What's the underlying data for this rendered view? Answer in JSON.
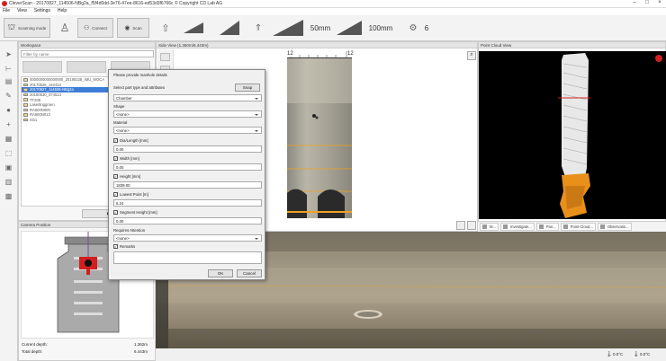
{
  "titlebar": {
    "title": "CleverScan - 20170827_114506-NBg2a_f5f4d0dd-3e76-47ee-8616-ed53d3f6766c © Copyright CD Lab AG"
  },
  "menu": [
    "File",
    "View",
    "Settings",
    "Help"
  ],
  "toolbar": {
    "scanning_mode": "Scanning mode",
    "connect": "Connect",
    "scan": "Scan",
    "distance1": "50mm",
    "distance2": "100mm",
    "count": "6"
  },
  "workspace": {
    "title": "Workspace",
    "filter_placeholder": "Filter by name",
    "process": "Process",
    "items": [
      "0000000000000000_20190228_IMU_MOCA",
      "20170526_142424",
      "20170827_114506-NBg2a",
      "20180530_074513",
      "TT205",
      "Laserlinggroen",
      "RA500N000",
      "RA500N013",
      "mb1"
    ],
    "selected_index": 2
  },
  "camera": {
    "title": "Camera Position",
    "current_depth_label": "Current depth:",
    "current_depth": "1.362m",
    "total_depth_label": "Total depth:",
    "total_depth": "6.443m"
  },
  "sideview": {
    "title": "Side View (1.350m/6.443m)",
    "ruler": [
      "12",
      "12"
    ]
  },
  "pointcloud": {
    "title": "Point Cloud View"
  },
  "bottom_tabs": [
    "M...",
    "Investigate...",
    "Pan...",
    "Point Cloud...",
    "Observatio..."
  ],
  "status": {
    "temp1": "0.0°C",
    "temp2": "0.0°C"
  },
  "dialog": {
    "title": "Please provide manhole details",
    "select_label": "Select part type and attributes",
    "snap": "Snap",
    "part_type": "Chamber",
    "shape_label": "Shape",
    "shape_value": "<none>",
    "material_label": "Material",
    "material_value": "<none>",
    "dia_label": "Dia/Length [mm]",
    "dia_value": "0.00",
    "width_label": "Width [mm]",
    "width_value": "0.00",
    "height_label": "Height [mm]",
    "height_value": "1839.00",
    "lowest_label": "Lowest Point [m]",
    "lowest_value": "6.24",
    "segment_label": "Segment Height [mm]",
    "segment_value": "0.00",
    "attention_label": "Requires Attention",
    "attention_value": "<none>",
    "remarks_label": "Remarks",
    "remarks_value": "",
    "ok": "OK",
    "cancel": "Cancel"
  },
  "colors": {
    "accent": "#3d7dd6",
    "logo": "#d21f1f",
    "measure_line": "#f0a020",
    "cloud_orange": "#e8901a"
  }
}
